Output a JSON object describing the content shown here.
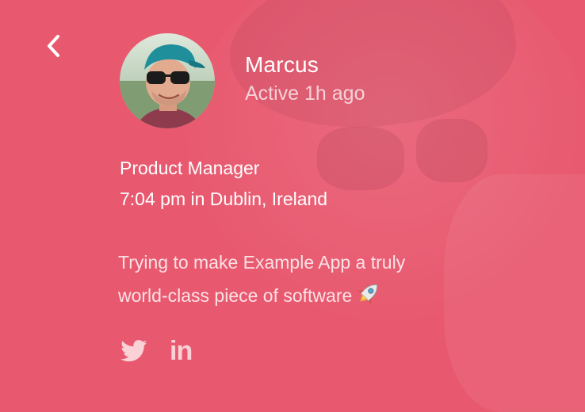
{
  "profile": {
    "name": "Marcus",
    "status": "Active 1h ago",
    "job_title": "Product Manager",
    "local_time": "7:04 pm  in Dublin, Ireland",
    "bio_line1": "Trying to make Example App a truly",
    "bio_line2": "world-class piece of software"
  },
  "social": {
    "twitter_icon": "twitter-icon",
    "linkedin_label": "in"
  },
  "icons": {
    "back": "chevron-left-icon",
    "rocket": "rocket-icon"
  },
  "colors": {
    "background": "#e8596f",
    "text": "#ffffff",
    "muted_text": "#f6c1ca"
  }
}
